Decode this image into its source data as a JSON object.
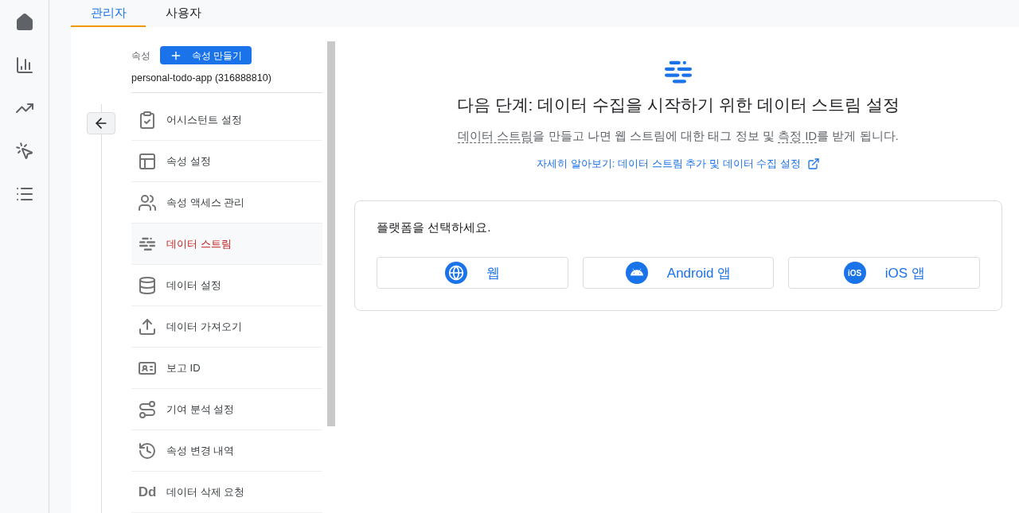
{
  "tabs": [
    {
      "label": "관리자",
      "selected": true
    },
    {
      "label": "사용자",
      "selected": false
    }
  ],
  "property": {
    "label": "속성",
    "create_button": "속성 만들기",
    "name": "personal-todo-app (316888810)"
  },
  "menu": [
    {
      "kind": "assistant",
      "label": "어시스턴트 설정",
      "selected": false
    },
    {
      "kind": "layout",
      "label": "속성 설정",
      "selected": false
    },
    {
      "kind": "people",
      "label": "속성 액세스 관리",
      "selected": false
    },
    {
      "kind": "stream",
      "label": "데이터 스트림",
      "selected": true
    },
    {
      "kind": "database",
      "label": "데이터 설정",
      "selected": false
    },
    {
      "kind": "upload",
      "label": "데이터 가져오기",
      "selected": false
    },
    {
      "kind": "reporting",
      "label": "보고 ID",
      "selected": false
    },
    {
      "kind": "attribution",
      "label": "기여 분석 설정",
      "selected": false
    },
    {
      "kind": "history",
      "label": "속성 변경 내역",
      "selected": false
    },
    {
      "kind": "text",
      "icon_text": "Dd",
      "label": "데이터 삭제 요청",
      "selected": false
    }
  ],
  "main": {
    "title": "다음 단계: 데이터 수집을 시작하기 위한 데이터 스트림 설정",
    "subtitle": [
      {
        "text": "데이터 스트림",
        "underlined": true
      },
      {
        "text": "을 만들고 나면 웹 스트림에 대한 태그 정보 및 ",
        "underlined": false
      },
      {
        "text": "측정 ID",
        "underlined": true
      },
      {
        "text": "를 받게 됩니다.",
        "underlined": false
      }
    ],
    "learn_more": "자세히 알아보기: 데이터 스트림 추가 및 데이터 수집 설정",
    "platform_prompt": "플랫폼을 선택하세요.",
    "platforms": [
      {
        "kind": "web",
        "label": "웹"
      },
      {
        "kind": "android",
        "label": "Android 앱"
      },
      {
        "kind": "ios",
        "icon_text": "iOS",
        "label": "iOS 앱"
      }
    ]
  }
}
